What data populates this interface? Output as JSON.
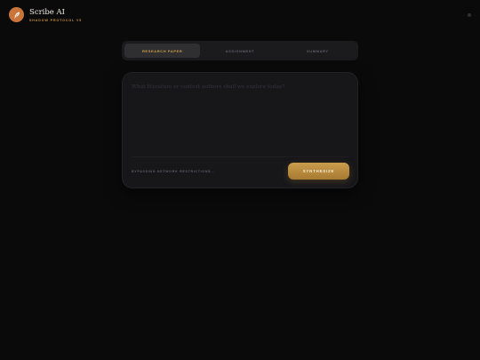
{
  "brand": {
    "title": "Scribe AI",
    "subtitle": "SHADOW PROTOCOL V5",
    "icon": "feather-icon",
    "accent": "#c8743a"
  },
  "tabs": [
    {
      "label": "RESEARCH PAPER",
      "active": true
    },
    {
      "label": "ASSIGNMENT",
      "active": false
    },
    {
      "label": "SUMMARY",
      "active": false
    }
  ],
  "composer": {
    "placeholder": "What literature or context authors shall we explore today?",
    "footer_note": "BYPASSING NETWORK RESTRICTIONS...",
    "submit_label": "SYNTHESIZE",
    "accent": "#c99d4d"
  }
}
